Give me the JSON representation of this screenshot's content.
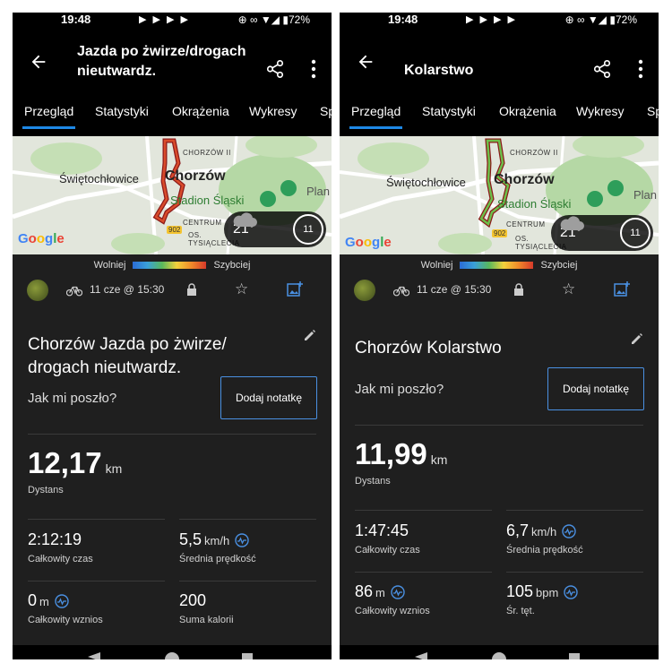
{
  "colors": {
    "accent": "#1e88e5",
    "note_border": "#4a90e2",
    "background": "#1f1f1f",
    "bar": "#000000"
  },
  "phones": [
    {
      "status": {
        "time": "19:48",
        "battery": "72%"
      },
      "title": "Jazda po żwirze/drogach nieutwardz.",
      "tabs": [
        "Przegląd",
        "Statystyki",
        "Okrążenia",
        "Wykresy",
        "Sp"
      ],
      "map": {
        "labels": [
          "Świętochłowice",
          "Chorzów",
          "Stadion Śląski",
          "Plan",
          "CENTRUM",
          "OS. TYSIĄCLECIA",
          "CHORZÓW II"
        ],
        "road": "902",
        "weather_temp": "21°",
        "wind": "11"
      },
      "legend": {
        "slower": "Wolniej",
        "faster": "Szybciej"
      },
      "date": "11 cze @ 15:30",
      "activity_title": "Chorzów Jazda po żwirze/ drogach nieutwardz.",
      "question": "Jak mi poszło?",
      "note_button": "Dodaj notatkę",
      "distance": {
        "value": "12,17",
        "unit": "km",
        "label": "Dystans"
      },
      "stats": [
        {
          "value": "2:12:19",
          "unit": "",
          "label": "Całkowity czas",
          "icon": ""
        },
        {
          "value": "5,5",
          "unit": "km/h",
          "label": "Średnia prędkość",
          "icon": "pulse-icon"
        },
        {
          "value": "0",
          "unit": "m",
          "label": "Całkowity wznios",
          "icon": "pulse-icon"
        },
        {
          "value": "200",
          "unit": "",
          "label": "Suma kalorii",
          "icon": ""
        }
      ]
    },
    {
      "status": {
        "time": "19:48",
        "battery": "72%"
      },
      "title": "Kolarstwo",
      "tabs": [
        "Przegląd",
        "Statystyki",
        "Okrążenia",
        "Wykresy",
        "Sp"
      ],
      "map": {
        "labels": [
          "Świętochłowice",
          "Chorzów",
          "Stadion Śląski",
          "Plan",
          "CENTRUM",
          "OS. TYSIĄCLECIA",
          "CHORZÓW II"
        ],
        "road": "902",
        "weather_temp": "21°",
        "wind": "11"
      },
      "legend": {
        "slower": "Wolniej",
        "faster": "Szybciej"
      },
      "date": "11 cze @ 15:30",
      "activity_title": "Chorzów Kolarstwo",
      "question": "Jak mi poszło?",
      "note_button": "Dodaj notatkę",
      "distance": {
        "value": "11,99",
        "unit": "km",
        "label": "Dystans"
      },
      "stats": [
        {
          "value": "1:47:45",
          "unit": "",
          "label": "Całkowity czas",
          "icon": ""
        },
        {
          "value": "6,7",
          "unit": "km/h",
          "label": "Średnia prędkość",
          "icon": "pulse-icon"
        },
        {
          "value": "86",
          "unit": "m",
          "label": "Całkowity wznios",
          "icon": "pulse-icon"
        },
        {
          "value": "105",
          "unit": "bpm",
          "label": "Śr. tęt.",
          "icon": "pulse-icon"
        }
      ]
    }
  ]
}
